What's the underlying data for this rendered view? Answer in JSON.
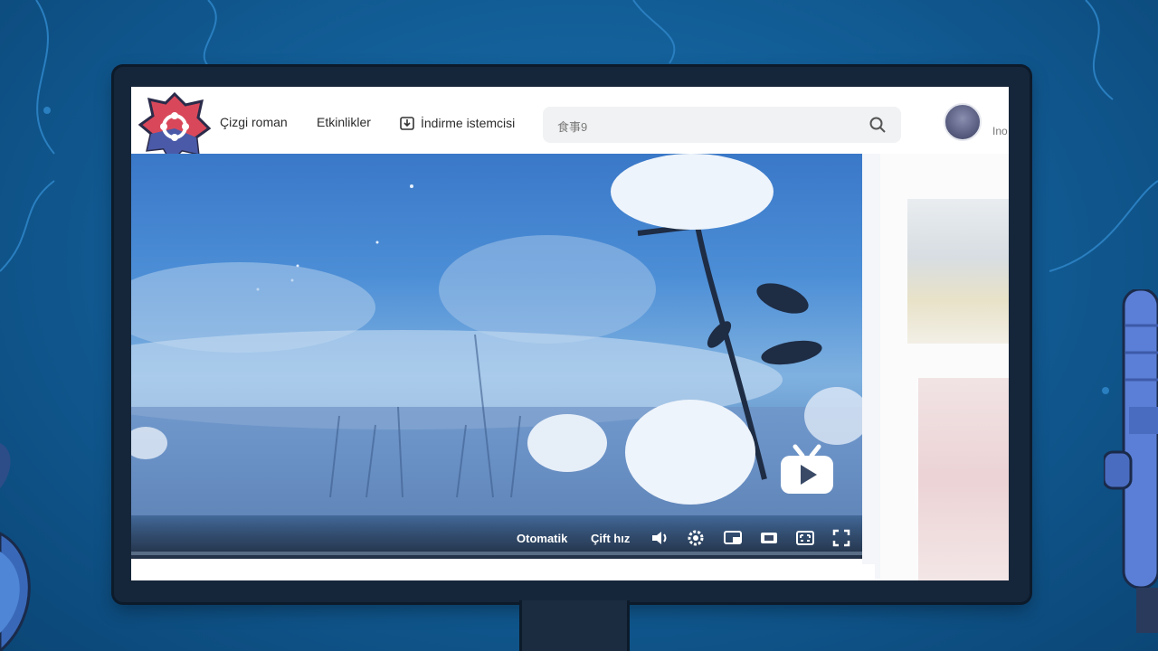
{
  "nav": {
    "comics": "Çizgi roman",
    "events": "Etkinlikler",
    "download": "İndirme istemcisi"
  },
  "search": {
    "placeholder": "食事9"
  },
  "user": {
    "name": "Ino"
  },
  "player": {
    "auto_label": "Otomatik",
    "speed_label": "Çift hız"
  },
  "icons": {
    "logo": "app-logo",
    "download": "download-icon",
    "search": "search-icon",
    "volume": "volume-icon",
    "settings": "gear-icon",
    "pip": "picture-in-picture-icon",
    "widescreen": "widescreen-icon",
    "webfullscreen": "web-fullscreen-icon",
    "fullscreen": "fullscreen-icon",
    "tv": "tv-play-icon"
  },
  "colors": {
    "background": "#115a92",
    "bezel": "#16263a",
    "logo_red": "#d9485a",
    "logo_blue": "#4a5aa8"
  }
}
